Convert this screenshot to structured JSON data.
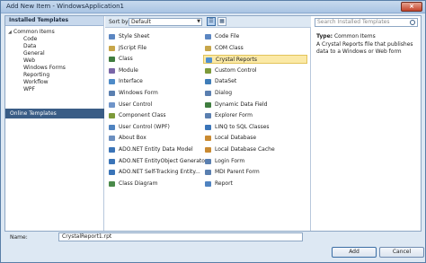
{
  "window": {
    "title": "Add New Item - WindowsApplication1",
    "close_glyph": "×"
  },
  "left_pane": {
    "header": "Installed Templates",
    "root": "Common Items",
    "children": [
      "Code",
      "Data",
      "General",
      "Web",
      "Windows Forms",
      "Reporting",
      "Workflow",
      "WPF"
    ],
    "online": "Online Templates"
  },
  "sortbar": {
    "label": "Sort by:",
    "value": "Default"
  },
  "items": [
    {
      "label": "Style Sheet",
      "icon": "style-sheet-icon",
      "color": "#5b86c2"
    },
    {
      "label": "JScript File",
      "icon": "jscript-file-icon",
      "color": "#c7a64a"
    },
    {
      "label": "Class",
      "icon": "class-icon",
      "color": "#3f7d3f"
    },
    {
      "label": "Module",
      "icon": "module-icon",
      "color": "#7a66a8"
    },
    {
      "label": "Interface",
      "icon": "interface-icon",
      "color": "#4d8bc8"
    },
    {
      "label": "Windows Form",
      "icon": "windows-form-icon",
      "color": "#5a7fb0"
    },
    {
      "label": "User Control",
      "icon": "user-control-icon",
      "color": "#6f94c9"
    },
    {
      "label": "Component Class",
      "icon": "component-class-icon",
      "color": "#7d9a3a"
    },
    {
      "label": "User Control (WPF)",
      "icon": "wpf-user-control-icon",
      "color": "#4f83c0"
    },
    {
      "label": "About Box",
      "icon": "about-box-icon",
      "color": "#6b8fc0"
    },
    {
      "label": "ADO.NET Entity Data Model",
      "icon": "entity-model-icon",
      "color": "#3a74b8"
    },
    {
      "label": "ADO.NET EntityObject Generator",
      "icon": "entityobject-generator-icon",
      "color": "#3a74b8"
    },
    {
      "label": "ADO.NET Self-Tracking Entity...",
      "icon": "self-tracking-entity-icon",
      "color": "#3a74b8"
    },
    {
      "label": "Class Diagram",
      "icon": "class-diagram-icon",
      "color": "#4a8a4a"
    },
    {
      "label": "Code File",
      "icon": "code-file-icon",
      "color": "#5b86c2"
    },
    {
      "label": "COM Class",
      "icon": "com-class-icon",
      "color": "#c7a64a"
    },
    {
      "label": "Crystal Reports",
      "icon": "crystal-reports-icon",
      "color": "#4f8fd1",
      "selected": true
    },
    {
      "label": "Custom Control",
      "icon": "custom-control-icon",
      "color": "#7d9a3a"
    },
    {
      "label": "DataSet",
      "icon": "dataset-icon",
      "color": "#3f7db8"
    },
    {
      "label": "Dialog",
      "icon": "dialog-icon",
      "color": "#5a7fb0"
    },
    {
      "label": "Dynamic Data Field",
      "icon": "dynamic-data-field-icon",
      "color": "#3f7d3f"
    },
    {
      "label": "Explorer Form",
      "icon": "explorer-form-icon",
      "color": "#5a7fb0"
    },
    {
      "label": "LINQ to SQL Classes",
      "icon": "linq-to-sql-icon",
      "color": "#3a74b8"
    },
    {
      "label": "Local Database",
      "icon": "local-database-icon",
      "color": "#c98a32"
    },
    {
      "label": "Local Database Cache",
      "icon": "local-database-cache-icon",
      "color": "#c98a32"
    },
    {
      "label": "Login Form",
      "icon": "login-form-icon",
      "color": "#5a7fb0"
    },
    {
      "label": "MDI Parent Form",
      "icon": "mdi-parent-form-icon",
      "color": "#5a7fb0"
    },
    {
      "label": "Report",
      "icon": "report-icon",
      "color": "#4f83c0"
    }
  ],
  "right_pane": {
    "search_placeholder": "Search Installed Templates",
    "type_label": "Type:",
    "type_value": "Common Items",
    "description": "A Crystal Reports file that publishes data to a Windows or Web form"
  },
  "footer": {
    "name_label": "Name:",
    "name_value": "CrystalReport1.rpt",
    "add_label": "Add",
    "cancel_label": "Cancel"
  }
}
